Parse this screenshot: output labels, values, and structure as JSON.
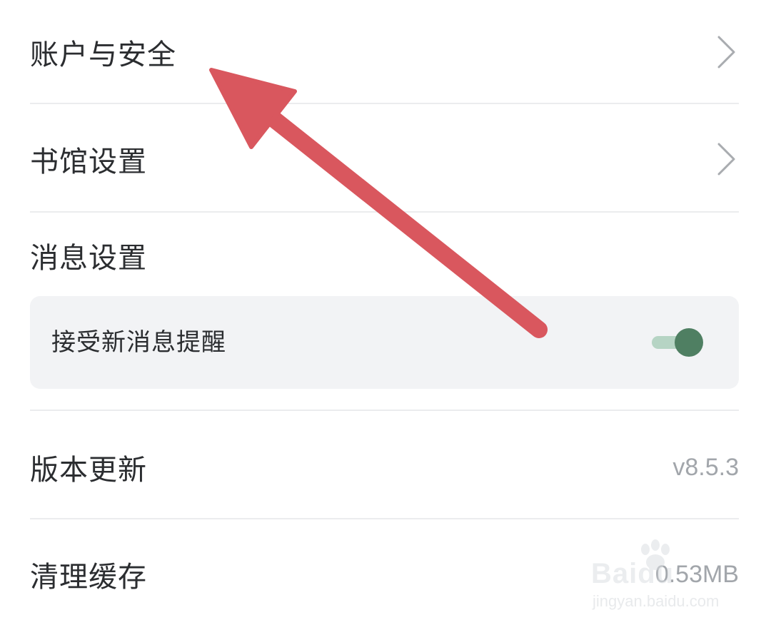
{
  "settings": {
    "account_security": {
      "label": "账户与安全"
    },
    "library_settings": {
      "label": "书馆设置"
    },
    "message_settings": {
      "title": "消息设置",
      "new_message_alert": {
        "label": "接受新消息提醒",
        "enabled": true
      }
    },
    "version_update": {
      "label": "版本更新",
      "value": "v8.5.3"
    },
    "clear_cache": {
      "label": "清理缓存",
      "value": "0.53MB"
    }
  },
  "watermark": {
    "brand": "Baidu",
    "site": "jingyan.baidu.com"
  },
  "colors": {
    "text_primary": "#2b2d30",
    "text_secondary": "#a2a6ab",
    "divider": "#ebecee",
    "card_bg": "#f2f3f5",
    "toggle_on": "#4f7f62",
    "toggle_track": "#b6d4c4",
    "annotation_arrow": "#d9575e"
  },
  "icons": {
    "row_chevron": "chevron-right-icon",
    "annotation": "red-arrow-annotation"
  }
}
